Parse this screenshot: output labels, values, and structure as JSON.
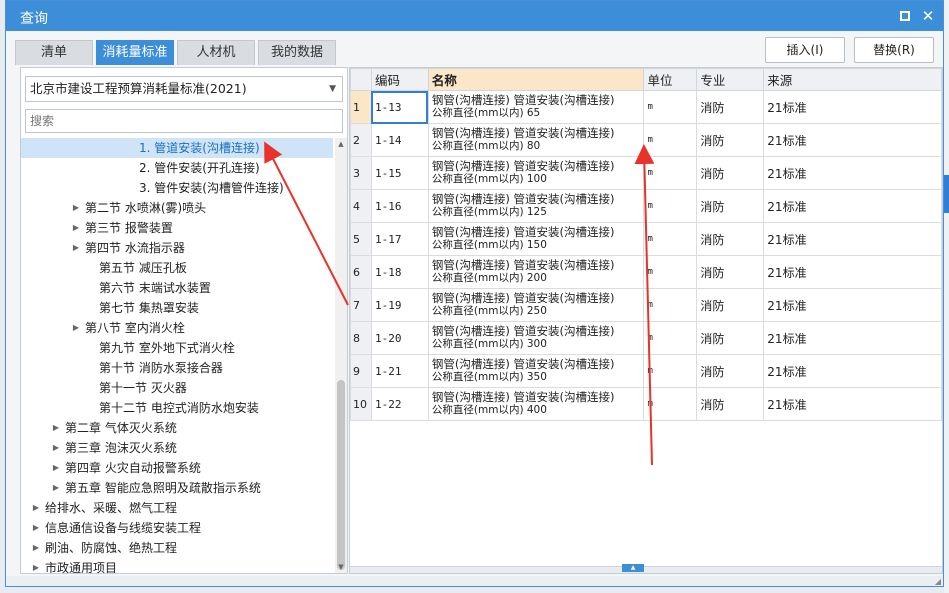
{
  "window": {
    "title": "查询",
    "max_icon": "maximize-icon",
    "close_icon": "close-icon",
    "close_glyph": "✕"
  },
  "tabs": [
    {
      "label": "清单"
    },
    {
      "label": "消耗量标准"
    },
    {
      "label": "人材机"
    },
    {
      "label": "我的数据"
    }
  ],
  "actions": {
    "insert": "插入(I)",
    "replace": "替换(R)"
  },
  "left": {
    "standard": "北京市建设工程预算消耗量标准(2021)",
    "search_placeholder": "搜索",
    "tree": [
      {
        "label": "1. 管道安装(沟槽连接)",
        "expandable": false
      },
      {
        "label": "2. 管件安装(开孔连接)",
        "expandable": false
      },
      {
        "label": "3. 管件安装(沟槽管件连接)",
        "expandable": false
      },
      {
        "label": "第二节 水喷淋(雾)喷头",
        "expandable": true
      },
      {
        "label": "第三节 报警装置",
        "expandable": true
      },
      {
        "label": "第四节 水流指示器",
        "expandable": true
      },
      {
        "label": "第五节 减压孔板",
        "expandable": false
      },
      {
        "label": "第六节 末端试水装置",
        "expandable": false
      },
      {
        "label": "第七节 集热罩安装",
        "expandable": false
      },
      {
        "label": "第八节 室内消火栓",
        "expandable": true
      },
      {
        "label": "第九节 室外地下式消火栓",
        "expandable": false
      },
      {
        "label": "第十节 消防水泵接合器",
        "expandable": false
      },
      {
        "label": "第十一节 灭火器",
        "expandable": false
      },
      {
        "label": "第十二节 电控式消防水炮安装",
        "expandable": false
      },
      {
        "label": "第二章 气体灭火系统",
        "expandable": true
      },
      {
        "label": "第三章 泡沫灭火系统",
        "expandable": true
      },
      {
        "label": "第四章 火灾自动报警系统",
        "expandable": true
      },
      {
        "label": "第五章 智能应急照明及疏散指示系统",
        "expandable": true
      },
      {
        "label": "给排水、采暖、燃气工程",
        "expandable": true
      },
      {
        "label": "信息通信设备与线缆安装工程",
        "expandable": true
      },
      {
        "label": "刷油、防腐蚀、绝热工程",
        "expandable": true
      },
      {
        "label": "市政通用项目",
        "expandable": true
      }
    ]
  },
  "grid": {
    "headers": {
      "code": "编码",
      "name": "名称",
      "unit": "单位",
      "major": "专业",
      "source": "来源"
    },
    "rows": [
      {
        "num": "1",
        "code": "1-13",
        "name1": "钢管(沟槽连接) 管道安装(沟槽连接)",
        "name2": "公称直径(mm以内) 65",
        "unit": "m",
        "major": "消防",
        "source": "21标准"
      },
      {
        "num": "2",
        "code": "1-14",
        "name1": "钢管(沟槽连接) 管道安装(沟槽连接)",
        "name2": "公称直径(mm以内) 80",
        "unit": "m",
        "major": "消防",
        "source": "21标准"
      },
      {
        "num": "3",
        "code": "1-15",
        "name1": "钢管(沟槽连接) 管道安装(沟槽连接)",
        "name2": "公称直径(mm以内) 100",
        "unit": "m",
        "major": "消防",
        "source": "21标准"
      },
      {
        "num": "4",
        "code": "1-16",
        "name1": "钢管(沟槽连接) 管道安装(沟槽连接)",
        "name2": "公称直径(mm以内) 125",
        "unit": "m",
        "major": "消防",
        "source": "21标准"
      },
      {
        "num": "5",
        "code": "1-17",
        "name1": "钢管(沟槽连接) 管道安装(沟槽连接)",
        "name2": "公称直径(mm以内) 150",
        "unit": "m",
        "major": "消防",
        "source": "21标准"
      },
      {
        "num": "6",
        "code": "1-18",
        "name1": "钢管(沟槽连接) 管道安装(沟槽连接)",
        "name2": "公称直径(mm以内) 200",
        "unit": "m",
        "major": "消防",
        "source": "21标准"
      },
      {
        "num": "7",
        "code": "1-19",
        "name1": "钢管(沟槽连接) 管道安装(沟槽连接)",
        "name2": "公称直径(mm以内) 250",
        "unit": "m",
        "major": "消防",
        "source": "21标准"
      },
      {
        "num": "8",
        "code": "1-20",
        "name1": "钢管(沟槽连接) 管道安装(沟槽连接)",
        "name2": "公称直径(mm以内) 300",
        "unit": "m",
        "major": "消防",
        "source": "21标准"
      },
      {
        "num": "9",
        "code": "1-21",
        "name1": "钢管(沟槽连接) 管道安装(沟槽连接)",
        "name2": "公称直径(mm以内) 350",
        "unit": "m",
        "major": "消防",
        "source": "21标准"
      },
      {
        "num": "10",
        "code": "1-22",
        "name1": "钢管(沟槽连接) 管道安装(沟槽连接)",
        "name2": "公称直径(mm以内) 400",
        "unit": "m",
        "major": "消防",
        "source": "21标准"
      }
    ]
  },
  "colors": {
    "accent": "#3c8ed8",
    "highlight": "#fbe6c8",
    "annotation": "#e8322a"
  }
}
